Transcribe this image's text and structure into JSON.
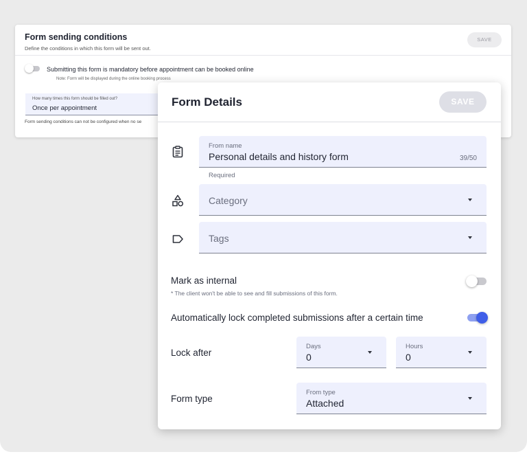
{
  "back_panel": {
    "title": "Form sending conditions",
    "subtitle": "Define the conditions in which this form will be sent out.",
    "save_label": "SAVE",
    "mandatory_label": "Submitting this form is mandatory before appointment can be booked online",
    "mandatory_note": "Note: Form will be displayed during the online booking process",
    "frequency_label": "How many times this form should be filled out?",
    "frequency_value": "Once per appointment",
    "footer_note": "Form sending conditions can not be configured when no se"
  },
  "form_details": {
    "title": "Form Details",
    "save_label": "SAVE",
    "form_name": {
      "label": "From name",
      "value": "Personal details and history form",
      "counter": "39/50",
      "helper": "Required"
    },
    "category": {
      "placeholder": "Category"
    },
    "tags": {
      "placeholder": "Tags"
    },
    "mark_internal": {
      "label": "Mark as internal",
      "note": "* The client won't be able to see and fill submissions of this form.",
      "enabled": false
    },
    "auto_lock": {
      "label": "Automatically lock completed submissions after a certain time",
      "enabled": true
    },
    "lock_after": {
      "label": "Lock after",
      "days_label": "Days",
      "days_value": "0",
      "hours_label": "Hours",
      "hours_value": "0"
    },
    "form_type": {
      "label": "Form type",
      "field_label": "From type",
      "value": "Attached"
    }
  },
  "icons": {
    "form_name": "clipboard-icon",
    "category": "shapes-icon",
    "tags": "tag-label-icon",
    "dropdown": "caret-down-icon"
  },
  "colors": {
    "accent": "#3f5ee8",
    "field_background": "#eef0fd",
    "save_disabled": "#dedfe6"
  }
}
